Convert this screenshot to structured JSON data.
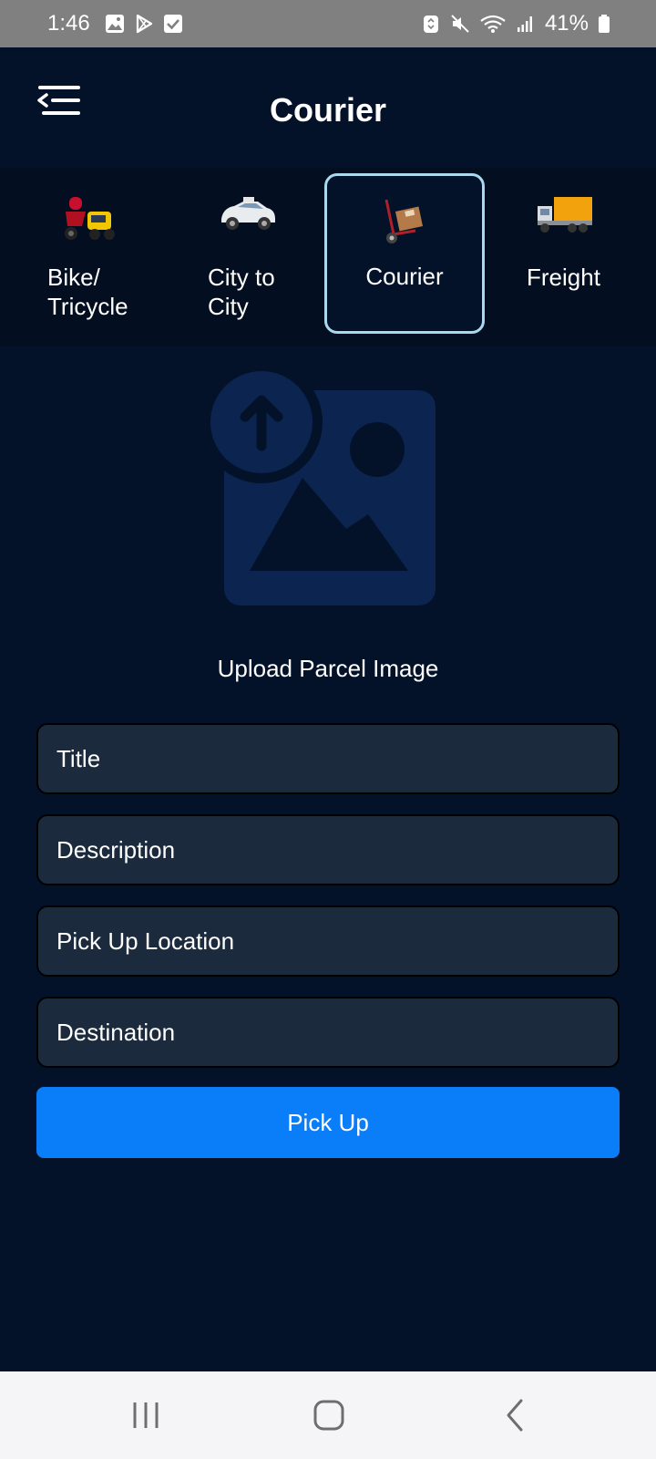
{
  "status_bar": {
    "time": "1:46",
    "battery": "41%",
    "left_icons": [
      "gallery-icon",
      "play-store-icon",
      "checkbox-icon"
    ],
    "right_icons": [
      "recycle-icon",
      "mute-icon",
      "wifi-icon",
      "signal-icon",
      "battery-icon"
    ]
  },
  "header": {
    "title": "Courier",
    "menu_icon": "menu-back-icon"
  },
  "categories": [
    {
      "label": "Bike/\nTricycle",
      "icon": "bike-tricycle-icon",
      "selected": false
    },
    {
      "label": "City to\nCity",
      "icon": "taxi-car-icon",
      "selected": false
    },
    {
      "label": "Courier",
      "icon": "hand-truck-parcel-icon",
      "selected": true
    },
    {
      "label": "Freight",
      "icon": "freight-truck-icon",
      "selected": false
    }
  ],
  "upload": {
    "label": "Upload Parcel Image",
    "icon": "image-upload-icon"
  },
  "form": {
    "title_placeholder": "Title",
    "description_placeholder": "Description",
    "pickup_placeholder": "Pick Up Location",
    "destination_placeholder": "Destination",
    "submit_label": "Pick Up"
  },
  "nav_bar": {
    "icons": [
      "recent-apps-icon",
      "home-icon",
      "back-icon"
    ]
  },
  "colors": {
    "background": "#041229",
    "field_background": "#1b2a3c",
    "accent": "#0a7df9",
    "selected_border": "#a9d9ef",
    "upload_icon": "#0b2550"
  }
}
